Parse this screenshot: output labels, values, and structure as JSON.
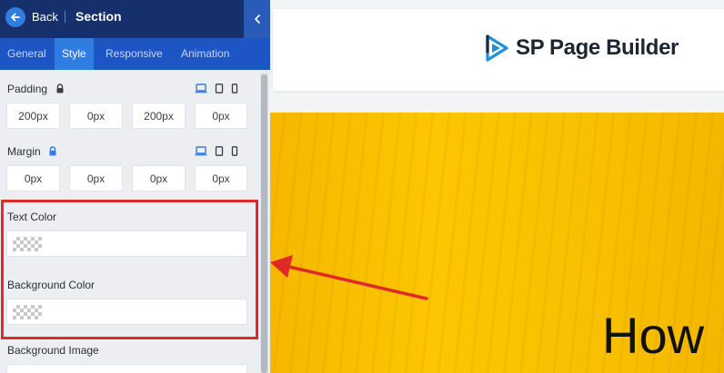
{
  "panel": {
    "back_label": "Back",
    "title": "Section",
    "tabs": [
      {
        "label": "General",
        "active": false
      },
      {
        "label": "Style",
        "active": true
      },
      {
        "label": "Responsive",
        "active": false
      },
      {
        "label": "Animation",
        "active": false
      }
    ],
    "padding": {
      "label": "Padding",
      "values": [
        "200px",
        "0px",
        "200px",
        "0px"
      ]
    },
    "margin": {
      "label": "Margin",
      "values": [
        "0px",
        "0px",
        "0px",
        "0px"
      ]
    },
    "text_color": {
      "label": "Text Color"
    },
    "background_color": {
      "label": "Background Color"
    },
    "background_image": {
      "label": "Background Image"
    }
  },
  "canvas": {
    "logo_text": "SP Page Builder",
    "hero_heading": "How"
  },
  "colors": {
    "topbar": "#15306b",
    "tabs": "#1d55c4",
    "accent": "#2f7de1",
    "highlight": "#e02a2a",
    "hero": "#fcc600"
  },
  "icons": [
    "back-arrow-icon",
    "chevron-left-icon",
    "lock-icon",
    "laptop-icon",
    "tablet-icon",
    "phone-icon",
    "sp-logo-icon"
  ]
}
